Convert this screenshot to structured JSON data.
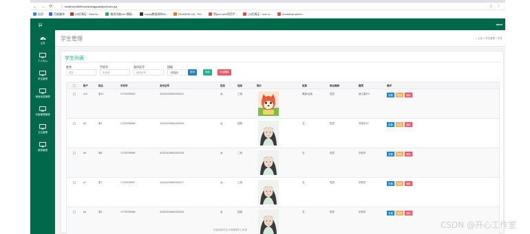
{
  "browser": {
    "url": "localhost:8080/xueshengguanliyu/index.jsp",
    "nav_glyphs": "← → ⟳",
    "bookmarks": [
      {
        "label": "应用",
        "color": "#4285f4"
      },
      {
        "label": "百度翻译",
        "color": "#2d6df6"
      },
      {
        "label": "(3)优满足 - freemu...",
        "color": "#c0392b"
      },
      {
        "label": "使用功能dox 模板...",
        "color": "#27ae60"
      },
      {
        "label": "mysql数据源的mi...",
        "color": "#333333"
      },
      {
        "label": "README.md - Tet...",
        "color": "#e67e22"
      },
      {
        "label": "把java web项目平...",
        "color": "#e74c3c"
      },
      {
        "label": "(3)优满足 - root ol...",
        "color": "#e74c3c"
      },
      {
        "label": "bootstrap-select...",
        "color": "#e74c3c"
      }
    ]
  },
  "app": {
    "logo": "µ",
    "user": "admi"
  },
  "sidebar": {
    "items": [
      {
        "label": "主页",
        "icon": "dashboard-icon"
      },
      {
        "label": "个人中心",
        "icon": "monitor-icon"
      },
      {
        "label": "学生管理",
        "icon": "monitor-icon"
      },
      {
        "label": "宿舍信息管理",
        "icon": "monitor-icon"
      },
      {
        "label": "访客管理管理",
        "icon": "monitor-icon"
      },
      {
        "label": "卫生管理",
        "icon": "monitor-icon"
      },
      {
        "label": "报修管理",
        "icon": "monitor-icon"
      }
    ]
  },
  "page": {
    "title": "学生管理",
    "breadcrumb": "⌂ 主页  >  学生管理  >  学生"
  },
  "list": {
    "title": "学生列表",
    "filters": {
      "name_label": "姓名",
      "name_placeholder": "姓名",
      "phone_label": "手机号",
      "phone_placeholder": "手机号",
      "idcard_label": "身份证号",
      "idcard_placeholder": "身份证号",
      "class_label": "班级",
      "class_value": "-请选择-",
      "search_btn": "查询",
      "add_btn": "添加",
      "batch_delete_btn": "批量删除"
    },
    "columns": [
      "账户",
      "姓名",
      "手机号",
      "身份证号",
      "性别",
      "班级",
      "照片",
      "民族",
      "政治面貌",
      "籍贯",
      "操作"
    ],
    "actions": {
      "view": "查看",
      "edit": "修改",
      "delete": "删除"
    },
    "rows": [
      {
        "account": "a10",
        "name": "张10",
        "phone": "17703789910",
        "idcard": "410224199610232021",
        "gender": "女",
        "class": "三班",
        "photo": "cartoon",
        "ethnic": "傣族/台族",
        "political": "党员",
        "origin": "浙江嘉兴1"
      },
      {
        "account": "a9",
        "name": "张9",
        "phone": "17703789999",
        "idcard": "410224199610232019",
        "gender": "女",
        "class": "四班",
        "photo": "portrait",
        "ethnic": "汉",
        "political": "党员",
        "origin": "华宏华12"
      },
      {
        "account": "a8",
        "name": "张8",
        "phone": "17703789998",
        "idcard": "410224199610232018",
        "gender": "女",
        "class": "二班",
        "photo": "portrait",
        "ethnic": "汉",
        "political": "党员",
        "origin": "华宏华"
      },
      {
        "account": "a7",
        "name": "张7",
        "phone": "17703789997",
        "idcard": "410224199610232017",
        "gender": "女",
        "class": "三班",
        "photo": "portrait",
        "ethnic": "汉",
        "political": "党员",
        "origin": "华宏华"
      },
      {
        "account": "a6",
        "name": "张6",
        "phone": "17703789996",
        "idcard": "410224199610232016",
        "gender": "女",
        "class": "四班",
        "photo": "portrait",
        "ethnic": "汉",
        "political": "党员",
        "origin": "华宏华"
      }
    ]
  },
  "footer": "欢迎使用学生公寓管理中心系统",
  "watermark": "CSDN @开心工作室",
  "colors": {
    "brand": "#00694b",
    "search": "#1c84c6",
    "add": "#1ab394",
    "delete": "#ed5565",
    "edit": "#f8ac59"
  }
}
